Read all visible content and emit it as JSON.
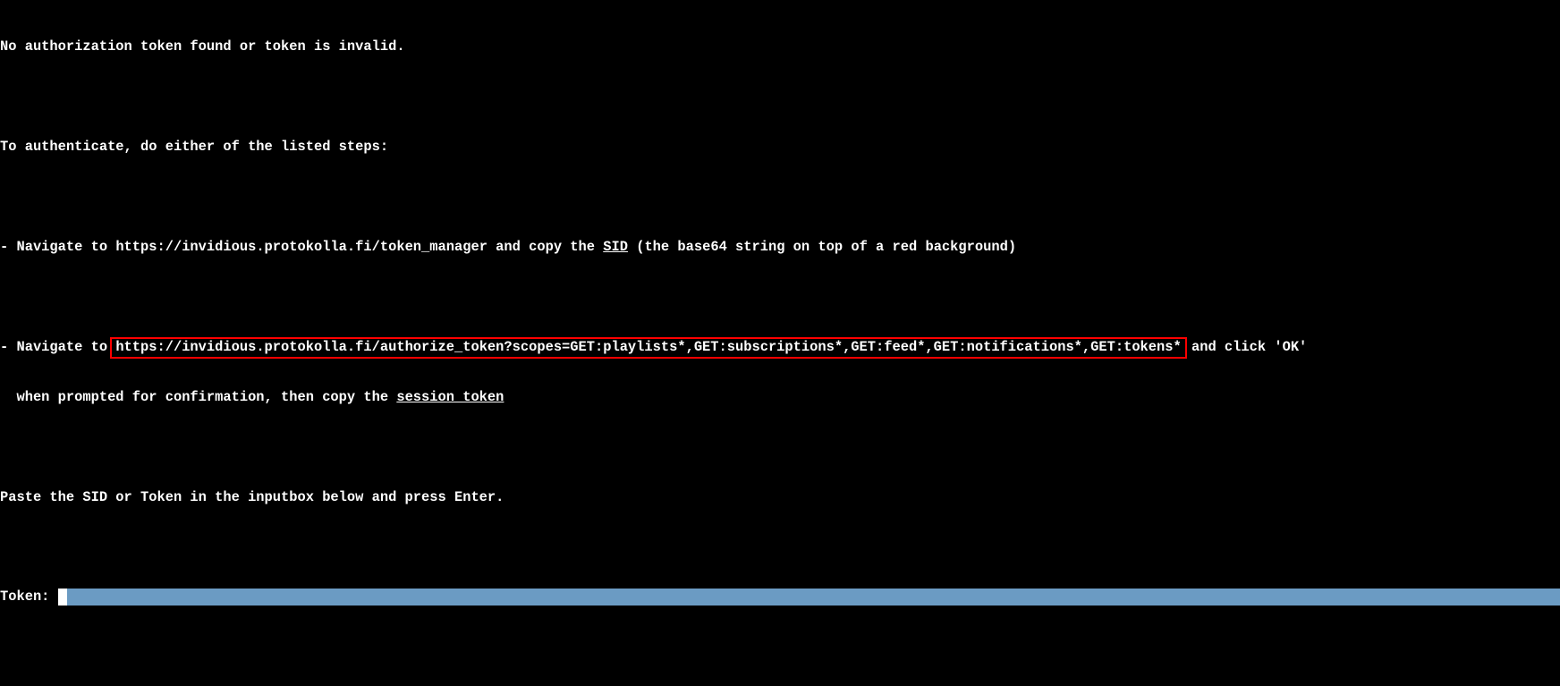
{
  "msg": {
    "error": "No authorization token found or token is invalid.",
    "auth_intro": "To authenticate, do either of the listed steps:",
    "step1_prefix": "- Navigate to ",
    "step1_url": "https://invidious.protokolla.fi/token_manager",
    "step1_mid": " and copy the ",
    "step1_sid": "SID",
    "step1_suffix": " (the base64 string on top of a red background)",
    "step2_prefix": "- Navigate to ",
    "step2_url": "https://invidious.protokolla.fi/authorize_token?scopes=GET:playlists*,GET:subscriptions*,GET:feed*,GET:notifications*,GET:tokens*",
    "step2_suffix": " and click 'OK'",
    "step2_line2_prefix": "  when prompted for confirmation, then copy the ",
    "step2_session_token": "session token",
    "paste_instruction": "Paste the SID or Token in the inputbox below and press Enter.",
    "token_label": "Token: ",
    "token_value": "",
    "token_placeholder": ""
  }
}
